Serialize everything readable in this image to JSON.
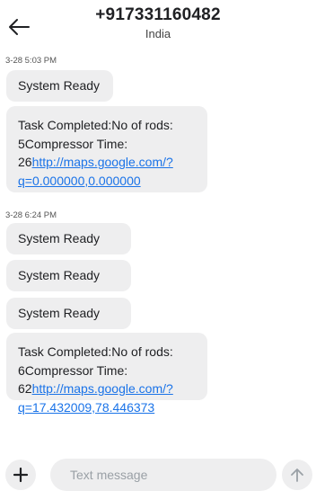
{
  "header": {
    "back_icon": "arrow-left-icon",
    "title": "+917331160482",
    "subtitle": "India"
  },
  "conversation": {
    "groups": [
      {
        "timestamp": "3-28 5:03 PM",
        "messages": [
          {
            "text": "System Ready"
          },
          {
            "line1": "Task Completed:No of rods:",
            "line2": "5Compressor Time:",
            "line3_prefix": "26",
            "link_line1": "http://maps.google.com/?",
            "link_line2": "q=0.000000,0.000000"
          }
        ]
      },
      {
        "timestamp": "3-28 6:24 PM",
        "messages": [
          {
            "text": "System Ready"
          },
          {
            "text": "System Ready"
          },
          {
            "text": "System Ready"
          },
          {
            "line1": "Task Completed:No of rods:",
            "line2": "6Compressor Time:",
            "line3_prefix": "62",
            "link_line1": "http://maps.google.com/?",
            "link_line2": "q=17.432009,78.446373"
          }
        ]
      }
    ]
  },
  "composer": {
    "attach_icon": "plus-icon",
    "placeholder": "Text message",
    "send_icon": "arrow-up-icon"
  },
  "colors": {
    "bubble_bg": "#eeeeef",
    "link": "#1a73e8",
    "text": "#202124"
  }
}
